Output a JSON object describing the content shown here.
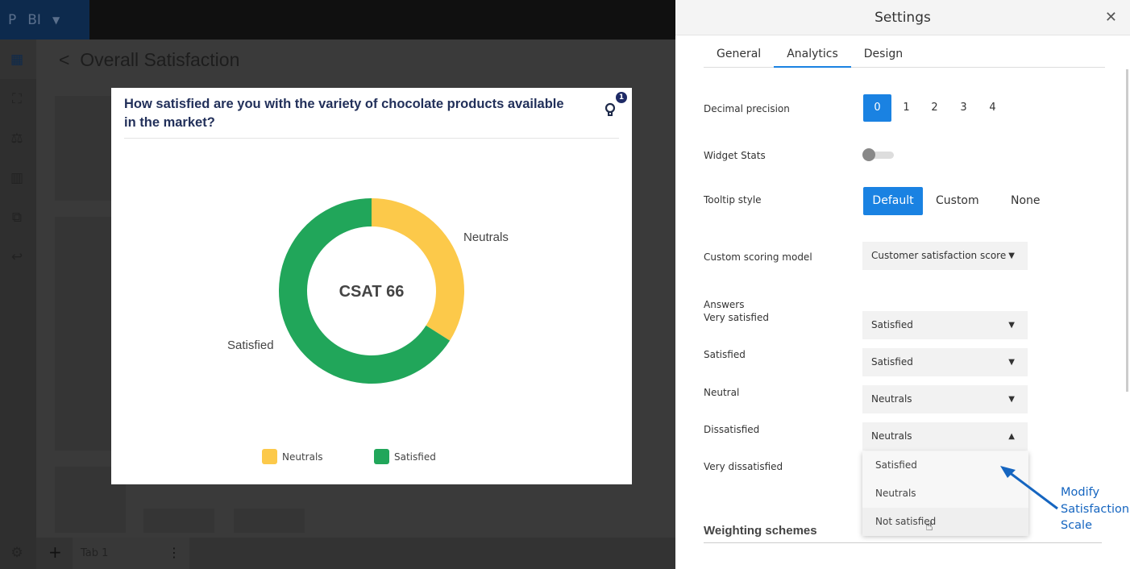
{
  "app": {
    "logo": "P",
    "name": "BI"
  },
  "page": {
    "title": "Overall Satisfaction"
  },
  "tabbar": {
    "tab": "Tab 1"
  },
  "widget": {
    "title": "How satisfied are you with the variety of chocolate products available in the market?",
    "notification_count": "1",
    "center_label": "CSAT 66"
  },
  "chart_data": {
    "type": "pie",
    "donut": true,
    "title": "How satisfied are you with the variety of chocolate products available in the market?",
    "center_label": "CSAT 66",
    "categories": [
      "Neutrals",
      "Satisfied"
    ],
    "values": [
      34,
      66
    ],
    "colors": [
      "#fcc94a",
      "#21a65a"
    ],
    "legend": "bottom"
  },
  "settings": {
    "title": "Settings",
    "tabs": [
      "General",
      "Analytics",
      "Design"
    ],
    "active_tab": "Analytics",
    "decimal_precision": {
      "label": "Decimal precision",
      "options": [
        "0",
        "1",
        "2",
        "3",
        "4"
      ],
      "selected": "0"
    },
    "widget_stats": {
      "label": "Widget Stats",
      "on": false
    },
    "tooltip_style": {
      "label": "Tooltip style",
      "options": [
        "Default",
        "Custom",
        "None"
      ],
      "selected": "Default"
    },
    "scoring_model": {
      "label": "Custom scoring model",
      "value": "Customer satisfaction score"
    },
    "answers_label": "Answers",
    "answers": [
      {
        "label": "Very satisfied",
        "value": "Satisfied"
      },
      {
        "label": "Satisfied",
        "value": "Satisfied"
      },
      {
        "label": "Neutral",
        "value": "Neutrals"
      },
      {
        "label": "Dissatisfied",
        "value": "Neutrals"
      },
      {
        "label": "Very dissatisfied",
        "value": ""
      }
    ],
    "dropdown_options": [
      "Satisfied",
      "Neutrals",
      "Not satisfied"
    ],
    "weighting": "Weighting schemes"
  },
  "annotation": {
    "line1": "Modify",
    "line2": "Satisfaction",
    "line3": "Scale",
    "color": "#1565c0"
  }
}
